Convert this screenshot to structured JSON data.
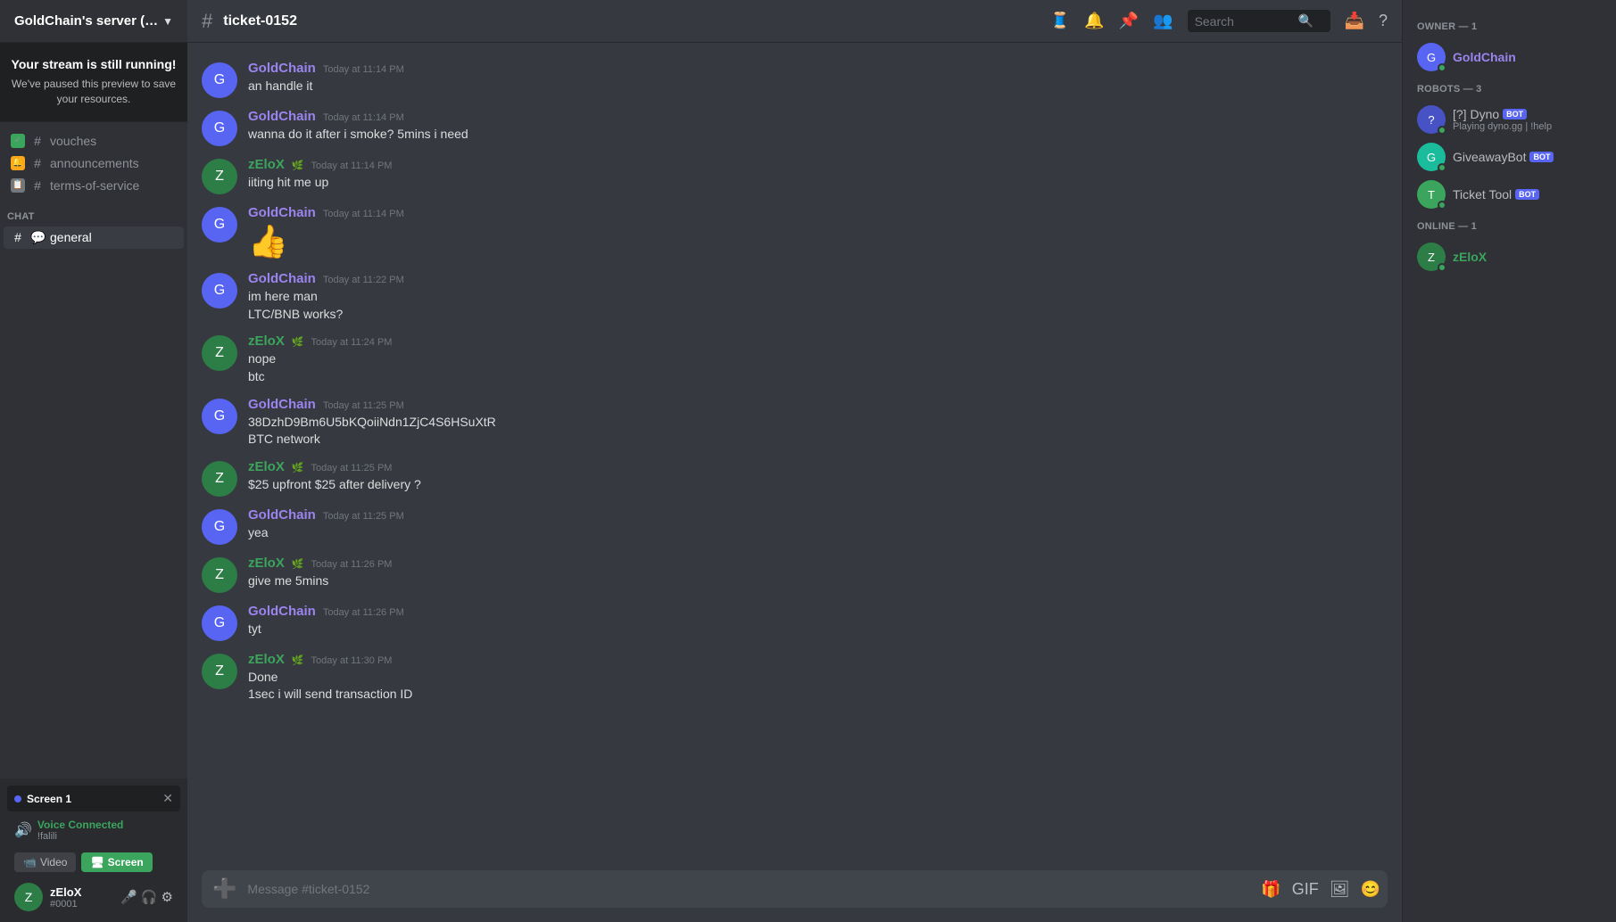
{
  "server": {
    "name": "GoldChain's server (Ama...",
    "chevron": "▼"
  },
  "stream_banner": {
    "title": "Your stream is still running!",
    "subtitle": "We've paused this preview to save your resources."
  },
  "channels": {
    "categories": [],
    "items": [
      {
        "name": "vouches",
        "badge": "green",
        "icon": "✓"
      },
      {
        "name": "announcements",
        "badge": "yellow",
        "icon": "🔔"
      },
      {
        "name": "terms-of-service",
        "badge": "gray",
        "icon": "📋"
      }
    ],
    "chat_label": "CHAT",
    "chat_items": [
      {
        "name": "general",
        "icon": "💬"
      }
    ]
  },
  "topbar": {
    "channel": "ticket-0152",
    "hash": "#",
    "icons": {
      "threads": "🧵",
      "mute": "🔔",
      "pin": "📌",
      "members": "👥",
      "search_placeholder": "Search",
      "inbox": "📥",
      "help": "?"
    }
  },
  "messages": [
    {
      "id": 1,
      "author": "GoldChain",
      "author_class": "gold",
      "timestamp": "Today at 11:14 PM",
      "lines": [
        "an handle it"
      ],
      "has_zelox_badge": false,
      "avatar_color": "purple"
    },
    {
      "id": 2,
      "author": "GoldChain",
      "author_class": "gold",
      "timestamp": "Today at 11:14 PM",
      "lines": [
        "wanna do it after i smoke? 5mins i need"
      ],
      "has_zelox_badge": false,
      "avatar_color": "purple"
    },
    {
      "id": 3,
      "author": "zEloX",
      "author_class": "zelox",
      "timestamp": "Today at 11:14 PM",
      "lines": [
        "iiting hit me up"
      ],
      "has_zelox_badge": true,
      "avatar_color": "green"
    },
    {
      "id": 4,
      "author": "GoldChain",
      "author_class": "gold",
      "timestamp": "Today at 11:14 PM",
      "lines": [
        "👍"
      ],
      "is_emoji": true,
      "has_zelox_badge": false,
      "avatar_color": "purple"
    },
    {
      "id": 5,
      "author": "GoldChain",
      "author_class": "gold",
      "timestamp": "Today at 11:22 PM",
      "lines": [
        "im here man",
        "LTC/BNB works?"
      ],
      "has_zelox_badge": false,
      "avatar_color": "purple"
    },
    {
      "id": 6,
      "author": "zEloX",
      "author_class": "zelox",
      "timestamp": "Today at 11:24 PM",
      "lines": [
        "nope",
        "btc"
      ],
      "has_zelox_badge": true,
      "avatar_color": "green"
    },
    {
      "id": 7,
      "author": "GoldChain",
      "author_class": "gold",
      "timestamp": "Today at 11:25 PM",
      "lines": [
        "38DzhD9Bm6U5bKQoiiNdn1ZjC4S6HSuXtR",
        "BTC network"
      ],
      "has_zelox_badge": false,
      "avatar_color": "purple"
    },
    {
      "id": 8,
      "author": "zEloX",
      "author_class": "zelox",
      "timestamp": "Today at 11:25 PM",
      "lines": [
        "$25 upfront $25 after delivery ?"
      ],
      "has_zelox_badge": true,
      "avatar_color": "green"
    },
    {
      "id": 9,
      "author": "GoldChain",
      "author_class": "gold",
      "timestamp": "Today at 11:25 PM",
      "lines": [
        "yea"
      ],
      "has_zelox_badge": false,
      "avatar_color": "purple"
    },
    {
      "id": 10,
      "author": "zEloX",
      "author_class": "zelox",
      "timestamp": "Today at 11:26 PM",
      "lines": [
        "give me 5mins"
      ],
      "has_zelox_badge": true,
      "avatar_color": "green"
    },
    {
      "id": 11,
      "author": "GoldChain",
      "author_class": "gold",
      "timestamp": "Today at 11:26 PM",
      "lines": [
        "tyt"
      ],
      "has_zelox_badge": false,
      "avatar_color": "purple"
    },
    {
      "id": 12,
      "author": "zEloX",
      "author_class": "zelox",
      "timestamp": "Today at 11:30 PM",
      "lines": [
        "Done",
        "1sec i will send transaction ID"
      ],
      "has_zelox_badge": true,
      "avatar_color": "green"
    }
  ],
  "message_input": {
    "placeholder": "Message #ticket-0152"
  },
  "right_panel": {
    "sections": [
      {
        "title": "OWNER — 1",
        "members": [
          {
            "name": "GoldChain",
            "name_class": "gold",
            "status": "online",
            "is_bot": false,
            "sub": ""
          }
        ]
      },
      {
        "title": "ROBOTS — 3",
        "members": [
          {
            "name": "[?] Dyno",
            "name_class": "bot",
            "status": "online",
            "is_bot": true,
            "sub": "Playing dyno.gg | !help"
          },
          {
            "name": "GiveawayBot",
            "name_class": "bot",
            "status": "online",
            "is_bot": true,
            "sub": ""
          },
          {
            "name": "Ticket Tool",
            "name_class": "bot",
            "status": "online",
            "is_bot": true,
            "sub": ""
          }
        ]
      },
      {
        "title": "ONLINE — 1",
        "members": [
          {
            "name": "zEloX",
            "name_class": "zelox",
            "status": "online",
            "is_bot": false,
            "sub": ""
          }
        ]
      }
    ]
  },
  "user": {
    "name": "zEloX",
    "discriminator": "#0001",
    "avatar_color": "green"
  },
  "screen": {
    "label": "Screen 1",
    "voice_status": "Voice Connected",
    "voice_channel": "!falili",
    "video_label": "Video",
    "screen_label": "Screen"
  }
}
